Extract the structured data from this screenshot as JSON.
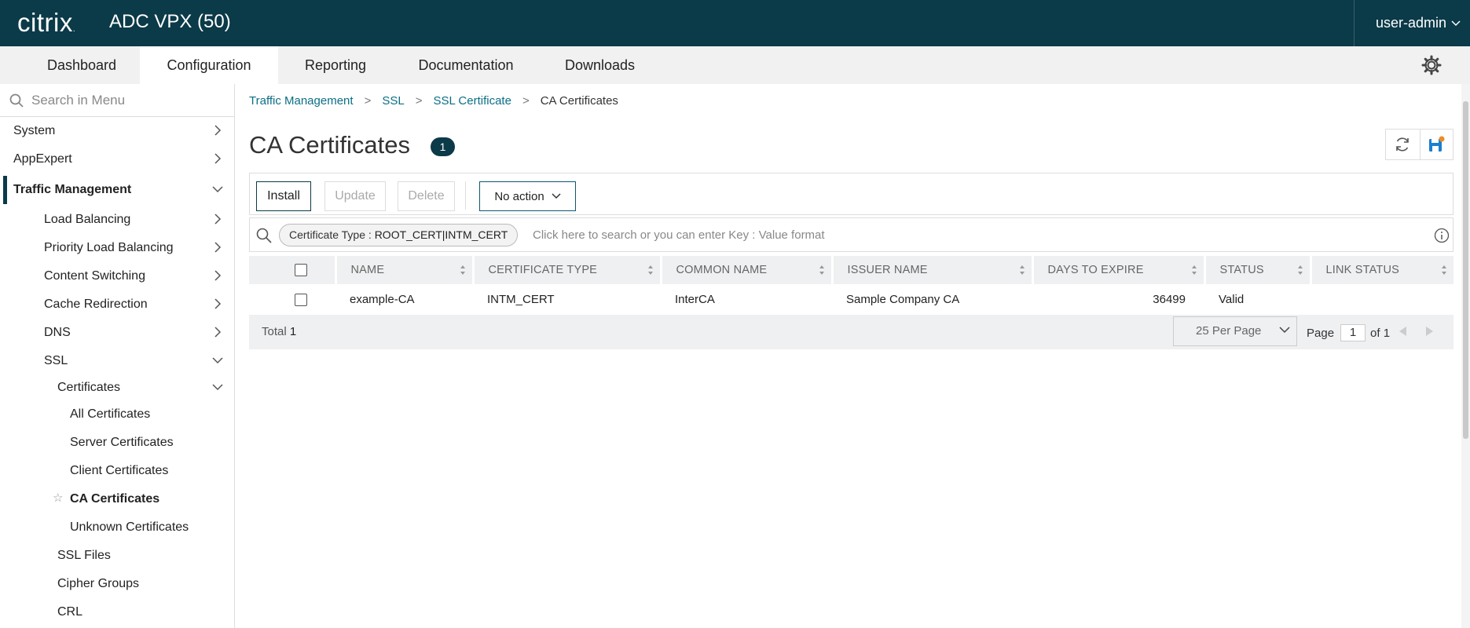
{
  "app": {
    "logo": "citrix",
    "title": "ADC VPX (50)",
    "user": "user-admin"
  },
  "tabs": [
    "Dashboard",
    "Configuration",
    "Reporting",
    "Documentation",
    "Downloads"
  ],
  "active_tab": "Configuration",
  "sidebar": {
    "search_placeholder": "Search in Menu",
    "items": [
      {
        "label": "System",
        "state": "collapsed"
      },
      {
        "label": "AppExpert",
        "state": "collapsed"
      },
      {
        "label": "Traffic Management",
        "state": "expanded",
        "selected": true
      },
      {
        "label": "Load Balancing",
        "state": "collapsed"
      },
      {
        "label": "Priority Load Balancing",
        "state": "collapsed"
      },
      {
        "label": "Content Switching",
        "state": "collapsed"
      },
      {
        "label": "Cache Redirection",
        "state": "collapsed"
      },
      {
        "label": "DNS",
        "state": "collapsed"
      },
      {
        "label": "SSL",
        "state": "expanded"
      },
      {
        "label": "Certificates",
        "state": "expanded"
      },
      {
        "label": "All Certificates"
      },
      {
        "label": "Server Certificates"
      },
      {
        "label": "Client Certificates"
      },
      {
        "label": "CA Certificates",
        "current": true
      },
      {
        "label": "Unknown Certificates"
      },
      {
        "label": "SSL Files"
      },
      {
        "label": "Cipher Groups"
      },
      {
        "label": "CRL"
      }
    ]
  },
  "breadcrumb": [
    "Traffic Management",
    "SSL",
    "SSL Certificate",
    "CA Certificates"
  ],
  "page": {
    "title": "CA Certificates",
    "count": "1"
  },
  "toolbar": {
    "install": "Install",
    "update": "Update",
    "delete": "Delete",
    "action": "No action"
  },
  "filter": {
    "chip_key": "Certificate Type : ",
    "chip_value": "ROOT_CERT|INTM_CERT",
    "hint": "Click here to search or you can enter Key : Value format"
  },
  "table": {
    "columns": [
      "NAME",
      "CERTIFICATE TYPE",
      "COMMON NAME",
      "ISSUER NAME",
      "DAYS TO EXPIRE",
      "STATUS",
      "LINK STATUS"
    ],
    "rows": [
      {
        "name": "example-CA",
        "certificate_type": "INTM_CERT",
        "common_name": "InterCA",
        "issuer_name": "Sample Company CA",
        "days_to_expire": "36499",
        "status": "Valid",
        "link_status": ""
      }
    ]
  },
  "footer": {
    "total_label": "Total",
    "total_value": "1",
    "per_page": "25 Per Page",
    "page_label": "Page",
    "page_value": "1",
    "of_label": "of 1"
  },
  "colors": {
    "header_bg": "#0b3a48",
    "link": "#0b6e87",
    "accent_orange": "#f08a24",
    "save_blue": "#1a7fd0"
  }
}
